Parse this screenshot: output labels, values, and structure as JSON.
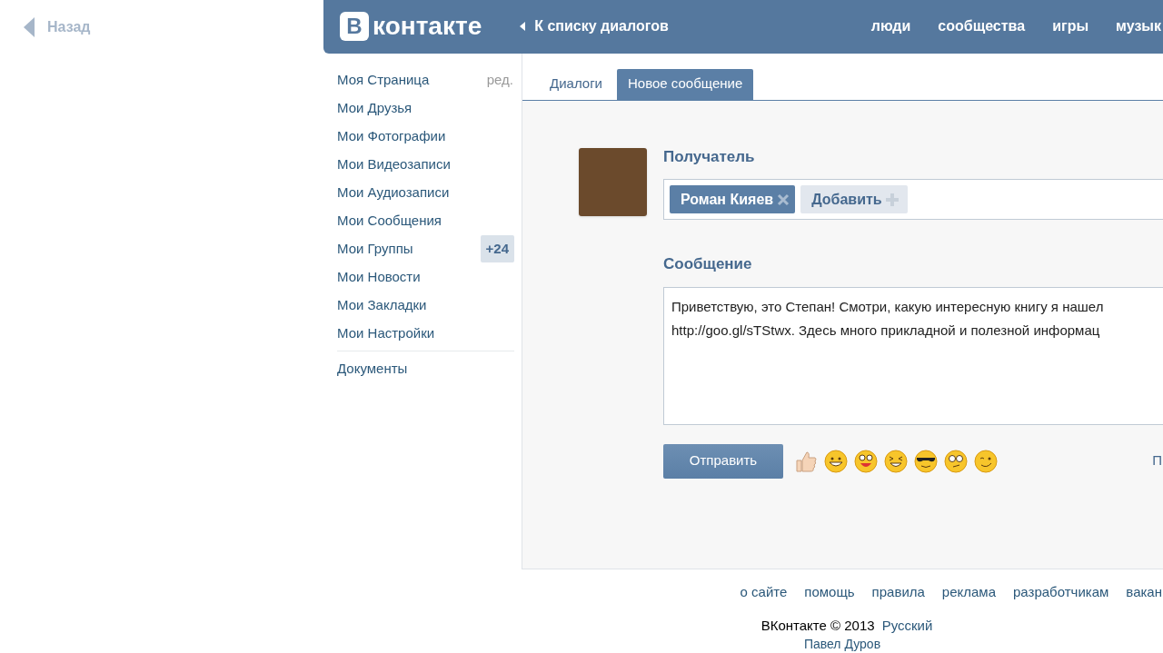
{
  "back": {
    "label": "Назад"
  },
  "header": {
    "logo_letter": "В",
    "logo_text": "контакте",
    "back_link": "К списку диалогов",
    "nav": [
      "люди",
      "сообщества",
      "игры",
      "музык"
    ]
  },
  "sidebar": {
    "items": [
      {
        "label": "Моя Страница",
        "action": "ред."
      },
      {
        "label": "Мои Друзья"
      },
      {
        "label": "Мои Фотографии"
      },
      {
        "label": "Мои Видеозаписи"
      },
      {
        "label": "Мои Аудиозаписи"
      },
      {
        "label": "Мои Сообщения"
      },
      {
        "label": "Мои Группы",
        "badge": "+24"
      },
      {
        "label": "Мои Новости"
      },
      {
        "label": "Мои Закладки"
      },
      {
        "label": "Мои Настройки"
      }
    ],
    "extra_items": [
      {
        "label": "Документы"
      }
    ]
  },
  "tabs": [
    {
      "label": "Диалоги",
      "selected": false
    },
    {
      "label": "Новое сообщение",
      "selected": true
    }
  ],
  "recipient": {
    "heading": "Получатель",
    "tokens": [
      "Роман Кияев"
    ],
    "add_label": "Добавить"
  },
  "message": {
    "heading": "Сообщение",
    "lines": [
      "Приветствую, это Степан! Смотри, какую интересную книгу я нашел",
      "http://goo.gl/sTStwx. Здесь много прикладной и полезной информац"
    ]
  },
  "send_button": "Отправить",
  "right_link": "П",
  "footer": {
    "links": [
      "о сайте",
      "помощь",
      "правила",
      "реклама",
      "разработчикам",
      "вакан"
    ],
    "copyright": "ВКонтакте © 2013",
    "language": "Русский",
    "author": "Павел Дуров"
  }
}
